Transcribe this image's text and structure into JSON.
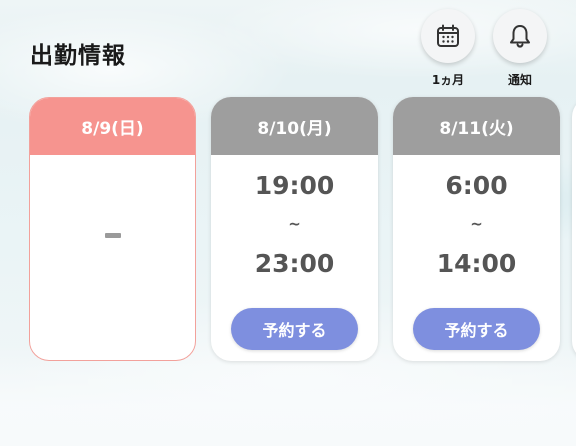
{
  "header": {
    "title": "出勤情報"
  },
  "actions": {
    "calendar_label": "1ヵ月",
    "notify_label": "通知"
  },
  "cards": [
    {
      "date": "8/9(日)",
      "status": "today",
      "empty_mark": "-"
    },
    {
      "date": "8/10(月)",
      "start": "19:00",
      "separator": "~",
      "end": "23:00",
      "button": "予約する"
    },
    {
      "date": "8/11(火)",
      "start": "6:00",
      "separator": "~",
      "end": "14:00",
      "button": "予約する"
    }
  ],
  "colors": {
    "today_header": "#f6948f",
    "other_header": "#9e9e9e",
    "reserve_button": "#7e8fdf"
  },
  "icons": {
    "calendar": "calendar-icon",
    "notify": "bell-icon"
  }
}
